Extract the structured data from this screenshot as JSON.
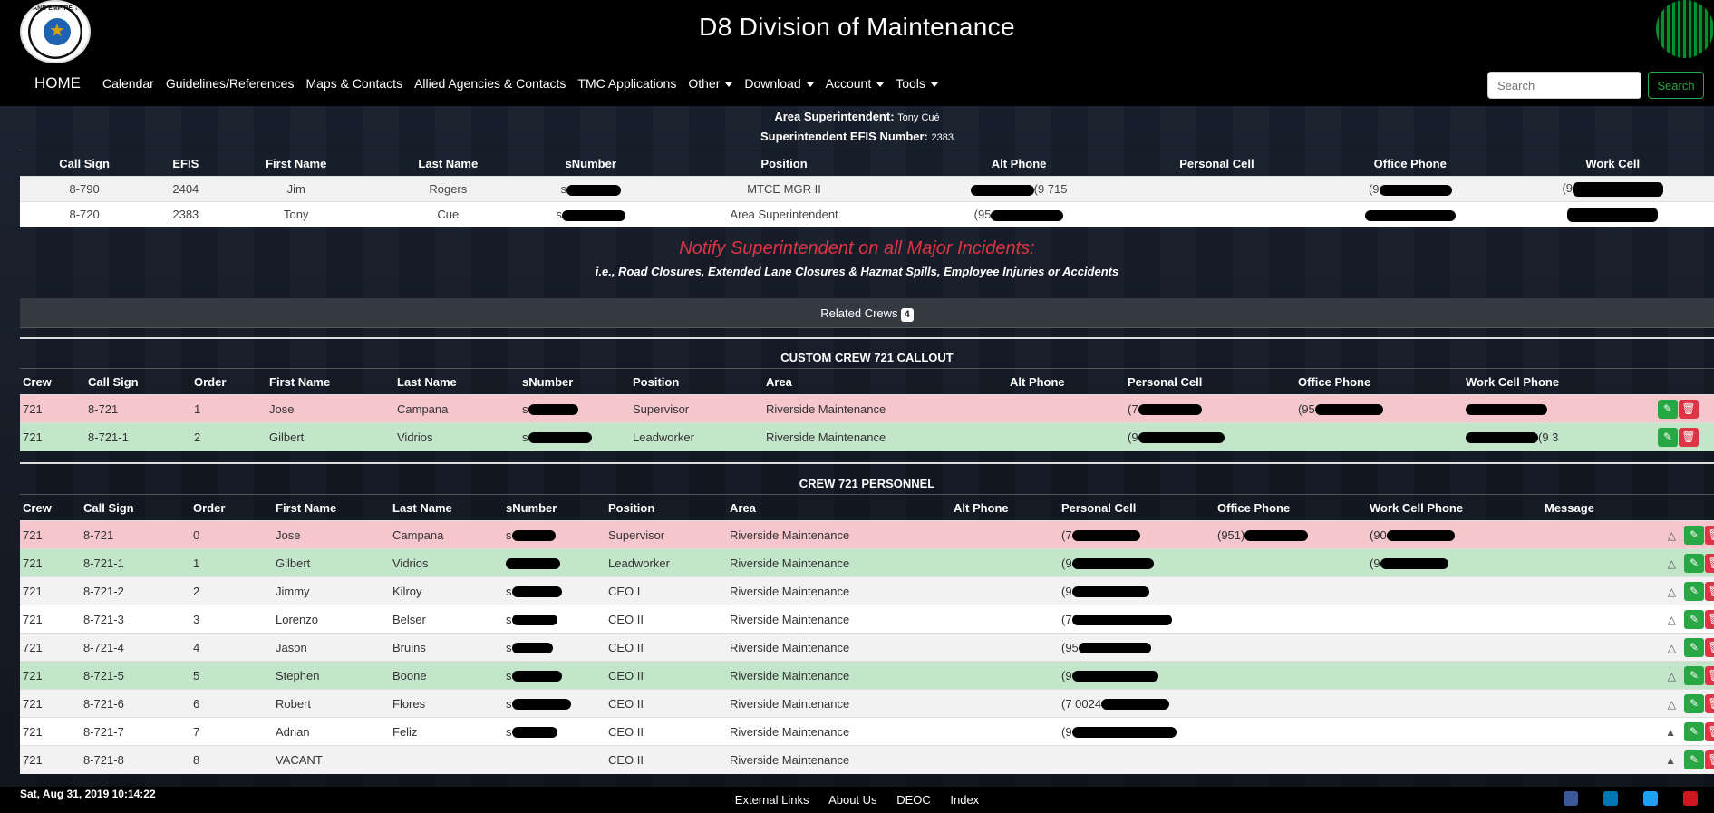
{
  "header": {
    "title": "D8 Division of Maintenance",
    "logo_text": "INLAND EMPIRE TMC",
    "nav": {
      "home": "HOME",
      "items": [
        "Calendar",
        "Guidelines/References",
        "Maps & Contacts",
        "Allied Agencies & Contacts",
        "TMC Applications",
        "Other",
        "Download",
        "Account",
        "Tools"
      ]
    },
    "search": {
      "placeholder": "Search",
      "button": "Search"
    }
  },
  "superintendent": {
    "label": "Area Superintendent:",
    "name": "Tony Cué",
    "efis_label": "Superintendent EFIS Number:",
    "efis": "2383"
  },
  "top_table": {
    "headers": [
      "Call Sign",
      "EFIS",
      "First Name",
      "Last Name",
      "sNumber",
      "Position",
      "Alt Phone",
      "Personal Cell",
      "Office Phone",
      "Work Cell"
    ],
    "rows": [
      {
        "call_sign": "8-790",
        "efis": "2404",
        "first": "Jim",
        "last": "Rogers",
        "snumber": "s",
        "position": "MTCE MGR II",
        "alt_phone": "(9   715",
        "office_phone": "(9",
        "work_cell": "(9"
      },
      {
        "call_sign": "8-720",
        "efis": "2383",
        "first": "Tony",
        "last": "Cue",
        "snumber": "s",
        "position": "Area Superintendent",
        "alt_phone": "(95",
        "office_phone": "",
        "work_cell": ""
      }
    ]
  },
  "notify": {
    "headline": "Notify Superintendent on all Major Incidents:",
    "detail": "i.e., Road Closures, Extended Lane Closures & Hazmat Spills, Employee Injuries or Accidents"
  },
  "related": {
    "label": "Related Crews",
    "count": "4"
  },
  "callout": {
    "title": "CUSTOM CREW 721 CALLOUT",
    "headers": [
      "Crew",
      "Call Sign",
      "Order",
      "First Name",
      "Last Name",
      "sNumber",
      "Position",
      "Area",
      "Alt Phone",
      "Personal Cell",
      "Office Phone",
      "Work Cell Phone"
    ],
    "rows": [
      {
        "crew": "721",
        "call_sign": "8-721",
        "order": "1",
        "first": "Jose",
        "last": "Campana",
        "snumber": "s",
        "position": "Supervisor",
        "area": "Riverside Maintenance",
        "personal": "(7",
        "office": "(95",
        "work": ""
      },
      {
        "crew": "721",
        "call_sign": "8-721-1",
        "order": "2",
        "first": "Gilbert",
        "last": "Vidrios",
        "snumber": "s",
        "position": "Leadworker",
        "area": "Riverside Maintenance",
        "personal": "(9",
        "office": "",
        "work": "(9    3"
      }
    ]
  },
  "personnel": {
    "title": "CREW 721 PERSONNEL",
    "headers": [
      "Crew",
      "Call Sign",
      "Order",
      "First Name",
      "Last Name",
      "sNumber",
      "Position",
      "Area",
      "Alt Phone",
      "Personal Cell",
      "Office Phone",
      "Work Cell Phone",
      "Message"
    ],
    "rows": [
      {
        "crew": "721",
        "call_sign": "8-721",
        "order": "0",
        "first": "Jose",
        "last": "Campana",
        "snumber": "s",
        "position": "Supervisor",
        "area": "Riverside Maintenance",
        "personal": "(7",
        "office": "(951)",
        "work": "(90",
        "msg": "△"
      },
      {
        "crew": "721",
        "call_sign": "8-721-1",
        "order": "1",
        "first": "Gilbert",
        "last": "Vidrios",
        "snumber": "",
        "position": "Leadworker",
        "area": "Riverside Maintenance",
        "personal": "(9",
        "office": "",
        "work": "(9",
        "msg": "△"
      },
      {
        "crew": "721",
        "call_sign": "8-721-2",
        "order": "2",
        "first": "Jimmy",
        "last": "Kilroy",
        "snumber": "s",
        "position": "CEO I",
        "area": "Riverside Maintenance",
        "personal": "(9",
        "office": "",
        "work": "",
        "msg": "△"
      },
      {
        "crew": "721",
        "call_sign": "8-721-3",
        "order": "3",
        "first": "Lorenzo",
        "last": "Belser",
        "snumber": "s",
        "position": "CEO II",
        "area": "Riverside Maintenance",
        "personal": "(7",
        "office": "",
        "work": "",
        "msg": "△"
      },
      {
        "crew": "721",
        "call_sign": "8-721-4",
        "order": "4",
        "first": "Jason",
        "last": "Bruins",
        "snumber": "s",
        "position": "CEO II",
        "area": "Riverside Maintenance",
        "personal": "(95",
        "office": "",
        "work": "",
        "msg": "△"
      },
      {
        "crew": "721",
        "call_sign": "8-721-5",
        "order": "5",
        "first": "Stephen",
        "last": "Boone",
        "snumber": "s",
        "position": "CEO II",
        "area": "Riverside Maintenance",
        "personal": "(9",
        "office": "",
        "work": "",
        "msg": "△"
      },
      {
        "crew": "721",
        "call_sign": "8-721-6",
        "order": "6",
        "first": "Robert",
        "last": "Flores",
        "snumber": "s",
        "position": "CEO II",
        "area": "Riverside Maintenance",
        "personal": "(7    0024",
        "office": "",
        "work": "",
        "msg": "△"
      },
      {
        "crew": "721",
        "call_sign": "8-721-7",
        "order": "7",
        "first": "Adrian",
        "last": "Feliz",
        "snumber": "s",
        "position": "CEO II",
        "area": "Riverside Maintenance",
        "personal": "(9",
        "office": "",
        "work": "",
        "msg": "▲"
      },
      {
        "crew": "721",
        "call_sign": "8-721-8",
        "order": "8",
        "first": "VACANT",
        "last": "",
        "snumber": "",
        "position": "CEO II",
        "area": "Riverside Maintenance",
        "personal": "",
        "office": "",
        "work": "",
        "msg": "▲"
      }
    ]
  },
  "footer": {
    "timestamp": "Sat, Aug 31, 2019 10:14:22",
    "links": [
      "External Links",
      "About Us",
      "DEOC",
      "Index"
    ],
    "social": [
      "facebook-icon",
      "linkedin-icon",
      "twitter-icon",
      "youtube-icon"
    ]
  },
  "colors": {
    "accent_red": "#dc3545",
    "accent_green": "#28a745",
    "row_pink": "#f5c6cb",
    "row_green": "#c3e6cb"
  }
}
